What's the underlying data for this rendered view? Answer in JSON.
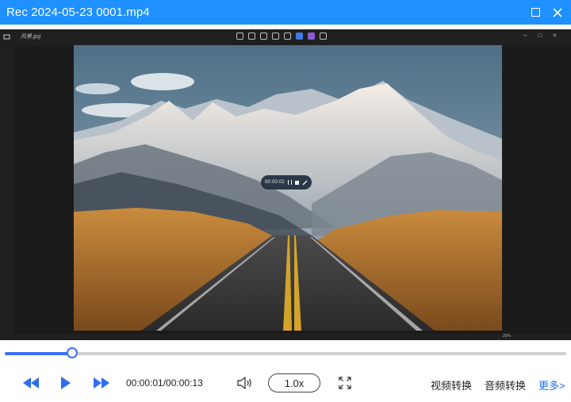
{
  "window": {
    "title": "Rec 2024-05-23 0001.mp4",
    "maximize_icon": "maximize-icon",
    "close_icon": "close-icon",
    "accent": "#1e90ff"
  },
  "inner_viewer": {
    "filename": "风景.jpg",
    "zoom": "20%",
    "recording_widget": {
      "time": "00:00:02"
    }
  },
  "player": {
    "progress": 0.12,
    "time": "00:00:01/00:00:13",
    "speed": "1.0x",
    "video_convert": "视频转换",
    "audio_convert": "音频转换",
    "more": "更多>",
    "accent": "#3b6ff5"
  }
}
